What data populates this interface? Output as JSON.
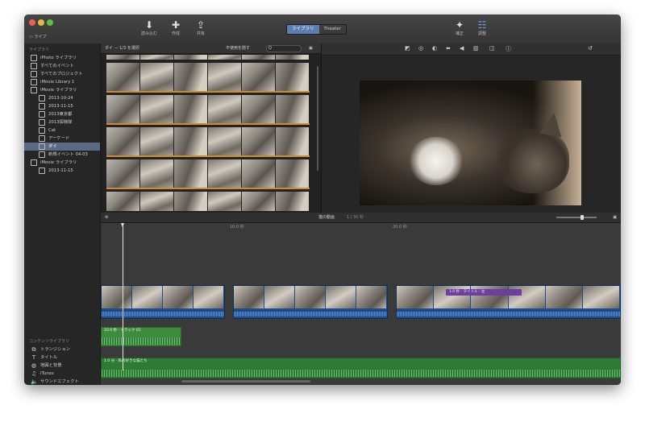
{
  "toolbar": {
    "library_button": "ライブ",
    "import_label": "読み込む",
    "create_label": "作成",
    "share_label": "共有",
    "seg_library": "ライブラリ",
    "seg_theater": "Theater",
    "enhance_label": "補正",
    "adjust_label": "調整"
  },
  "sidebar": {
    "libraries_header": "ライブラリ",
    "items": [
      {
        "label": "iPhoto ライブラリ",
        "icon": "star-icon"
      },
      {
        "label": "すべてのイベント",
        "icon": "square-icon"
      },
      {
        "label": "すべてのプロジェクト",
        "icon": "square-icon"
      },
      {
        "label": "iMovie Library 1",
        "icon": "library-icon"
      },
      {
        "label": "iMovie ライブラリ",
        "icon": "library-icon"
      },
      {
        "label": "2013-10-24",
        "icon": "event-icon"
      },
      {
        "label": "2013-11-15",
        "icon": "event-icon"
      },
      {
        "label": "2013東京都",
        "icon": "event-icon"
      },
      {
        "label": "2013探検隊",
        "icon": "event-icon"
      },
      {
        "label": "Cat",
        "icon": "event-icon"
      },
      {
        "label": "アーケード",
        "icon": "event-icon"
      },
      {
        "label": "ダイ",
        "icon": "event-icon"
      },
      {
        "label": "新規イベント 04-03",
        "icon": "event-icon"
      },
      {
        "label": "iMovie ライブラリ",
        "icon": "library-icon"
      },
      {
        "label": "2013-11-15",
        "icon": "event-icon"
      }
    ],
    "selected_index": 11,
    "content_header": "コンテンツライブラリ",
    "content_items": [
      {
        "label": "トランジション",
        "icon": "transition-icon"
      },
      {
        "label": "タイトル",
        "icon": "title-icon"
      },
      {
        "label": "地図と背景",
        "icon": "globe-icon"
      },
      {
        "label": "iTunes",
        "icon": "music-icon"
      },
      {
        "label": "サウンドエフェクト",
        "icon": "speaker-icon"
      },
      {
        "label": "GarageBand",
        "icon": "guitar-icon"
      }
    ]
  },
  "browser": {
    "title": "ダイ — 1/3 を選択",
    "filter": "不使用を隠す",
    "search_placeholder": "Q"
  },
  "timeline": {
    "title": "猫の動画",
    "duration": "1 / 30 秒",
    "ruler_1": "10.0 秒",
    "ruler_2": "20.0 秒",
    "title_clip": "1.0 秒 - タイトル - 左",
    "audio_clip_1": "10.0 秒 - トラック 01",
    "audio_clip_2": "1.0 分 - 私の好きな猫たち"
  }
}
